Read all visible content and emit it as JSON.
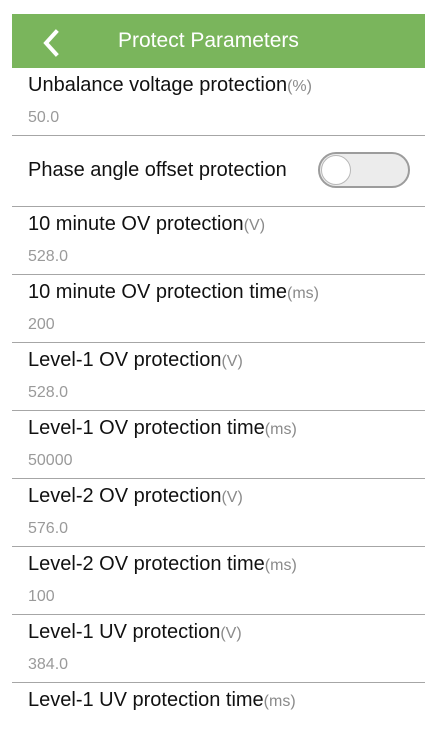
{
  "header": {
    "title": "Protect Parameters",
    "back_icon": "chevron-left-icon",
    "color": "#7ab55c"
  },
  "params": [
    {
      "label": "Unbalance voltage protection",
      "unit": "(%)",
      "value": "50.0"
    },
    {
      "label": "Phase angle offset protection",
      "toggle": false
    },
    {
      "label": "10 minute OV protection",
      "unit": "(V)",
      "value": "528.0"
    },
    {
      "label": "10 minute OV protection time",
      "unit": "(ms)",
      "value": "200"
    },
    {
      "label": "Level-1 OV protection",
      "unit": "(V)",
      "value": "528.0"
    },
    {
      "label": "Level-1 OV protection time",
      "unit": "(ms)",
      "value": "50000"
    },
    {
      "label": "Level-2 OV protection",
      "unit": "(V)",
      "value": "576.0"
    },
    {
      "label": "Level-2 OV protection time",
      "unit": "(ms)",
      "value": "100"
    },
    {
      "label": "Level-1 UV protection",
      "unit": "(V)",
      "value": "384.0"
    },
    {
      "label": "Level-1 UV protection time",
      "unit": "(ms)"
    }
  ]
}
